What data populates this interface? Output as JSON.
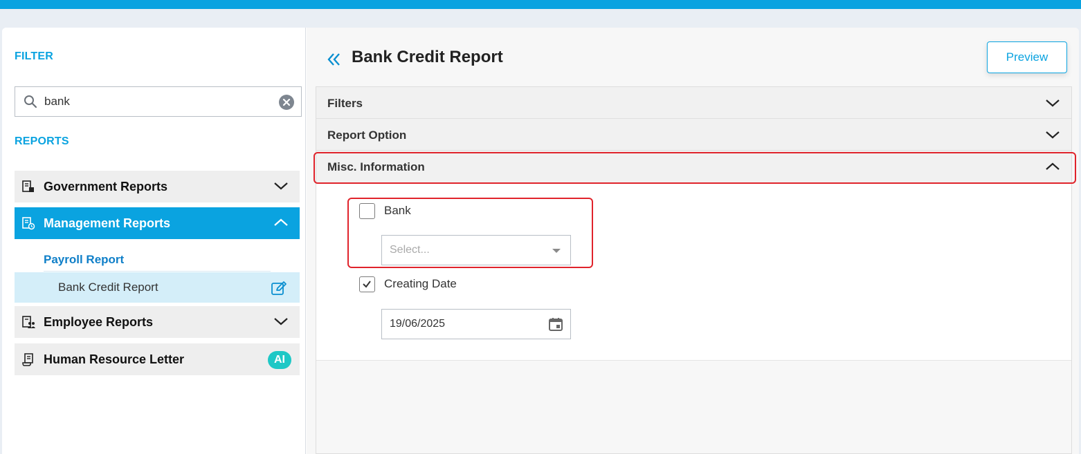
{
  "sidebar": {
    "filter_label": "FILTER",
    "search": {
      "value": "bank",
      "placeholder": ""
    },
    "reports_label": "REPORTS",
    "groups": [
      {
        "label": "Government Reports",
        "icon": "building-report-icon"
      },
      {
        "label": "Management Reports",
        "icon": "clock-report-icon"
      },
      {
        "label": "Employee Reports",
        "icon": "people-report-icon"
      },
      {
        "label": "Human Resource Letter",
        "icon": "scroll-icon",
        "badge": "AI"
      }
    ],
    "submenu": {
      "heading": "Payroll Report",
      "items": [
        {
          "label": "Bank Credit Report",
          "icon": "edit-icon"
        }
      ]
    }
  },
  "main": {
    "title": "Bank Credit Report",
    "preview_label": "Preview",
    "sections": [
      {
        "label": "Filters",
        "expanded": false
      },
      {
        "label": "Report Option",
        "expanded": false
      },
      {
        "label": "Misc. Information",
        "expanded": true
      }
    ],
    "fields": {
      "bank": {
        "label": "Bank",
        "checked": false,
        "placeholder": "Select..."
      },
      "creating_date": {
        "label": "Creating Date",
        "checked": true,
        "value": "19/06/2025"
      }
    }
  },
  "colors": {
    "accent": "#0aa3e0",
    "highlight": "#e0232b",
    "ai_badge": "#1ec8c6",
    "selected_item": "#d4eef9"
  }
}
